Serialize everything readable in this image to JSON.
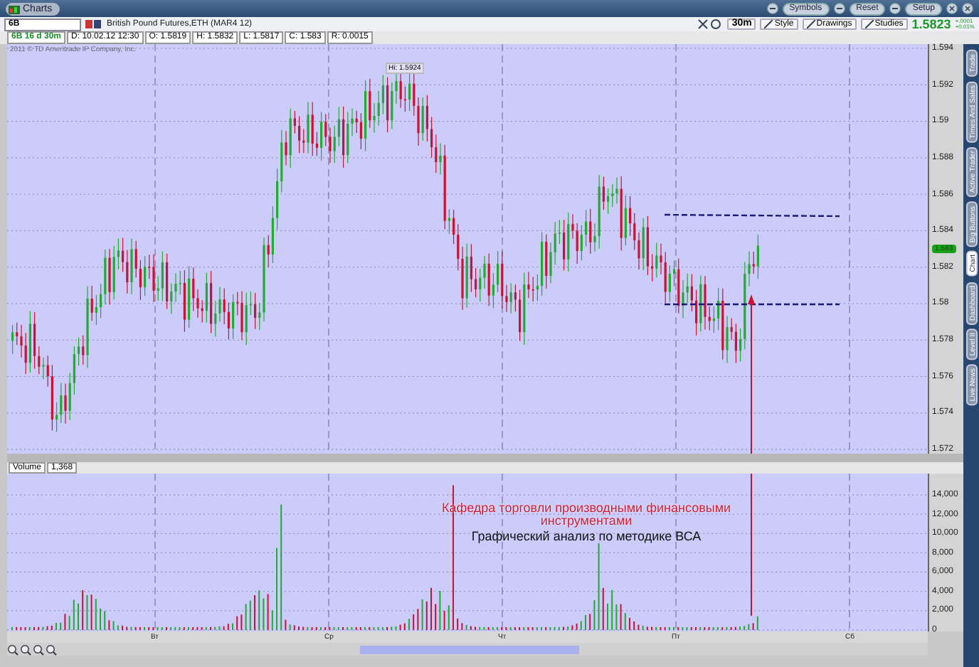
{
  "window": {
    "title": "Charts"
  },
  "title_buttons": [
    "Symbols",
    "Reset",
    "Setup"
  ],
  "symbol_bar": {
    "symbol": "6B",
    "description": "British Pound Futures,ETH (MAR4 12)"
  },
  "toolbar": {
    "interval": "30m",
    "buttons": [
      "Style",
      "Drawings",
      "Studies"
    ],
    "last_price": "1.5823",
    "change": [
      "+.0001",
      "+0.01%"
    ]
  },
  "info_bar": [
    "6B 16 d 30m",
    "D: 10.02.12 12:30",
    "O: 1.5819",
    "H: 1.5832",
    "L: 1.5817",
    "C: 1.583",
    "R: 0.0015"
  ],
  "copyright": "2011 © TD Ameritrade IP Company, Inc.",
  "high_label": "Hi: 1.5924",
  "price_axis": [
    "1.594",
    "1.592",
    "1.59",
    "1.588",
    "1.586",
    "1.584",
    "1.582",
    "1.58",
    "1.578",
    "1.576",
    "1.574",
    "1.572"
  ],
  "current_price": "1.583",
  "volume": {
    "label": "Volume",
    "value": "1,368"
  },
  "volume_axis": [
    "14,000",
    "12,000",
    "10,000",
    "8,000",
    "6,000",
    "4,000",
    "2,000",
    "0"
  ],
  "x_axis": [
    "Вт",
    "Ср",
    "Чт",
    "Пт",
    "Сб"
  ],
  "annotation": {
    "title": "Кафедра торговли производными финансовыми инструментами",
    "subtitle": "Графический анализ по методике ВСА"
  },
  "side_tabs": [
    {
      "label": "Trade",
      "selected": false
    },
    {
      "label": "Times And Sales",
      "selected": false
    },
    {
      "label": "Active Trader",
      "selected": false
    },
    {
      "label": "Big Buttons",
      "selected": false
    },
    {
      "label": "Chart",
      "selected": true
    },
    {
      "label": "Dashboard",
      "selected": false
    },
    {
      "label": "Level II",
      "selected": false
    },
    {
      "label": "Live News",
      "selected": false
    }
  ]
}
